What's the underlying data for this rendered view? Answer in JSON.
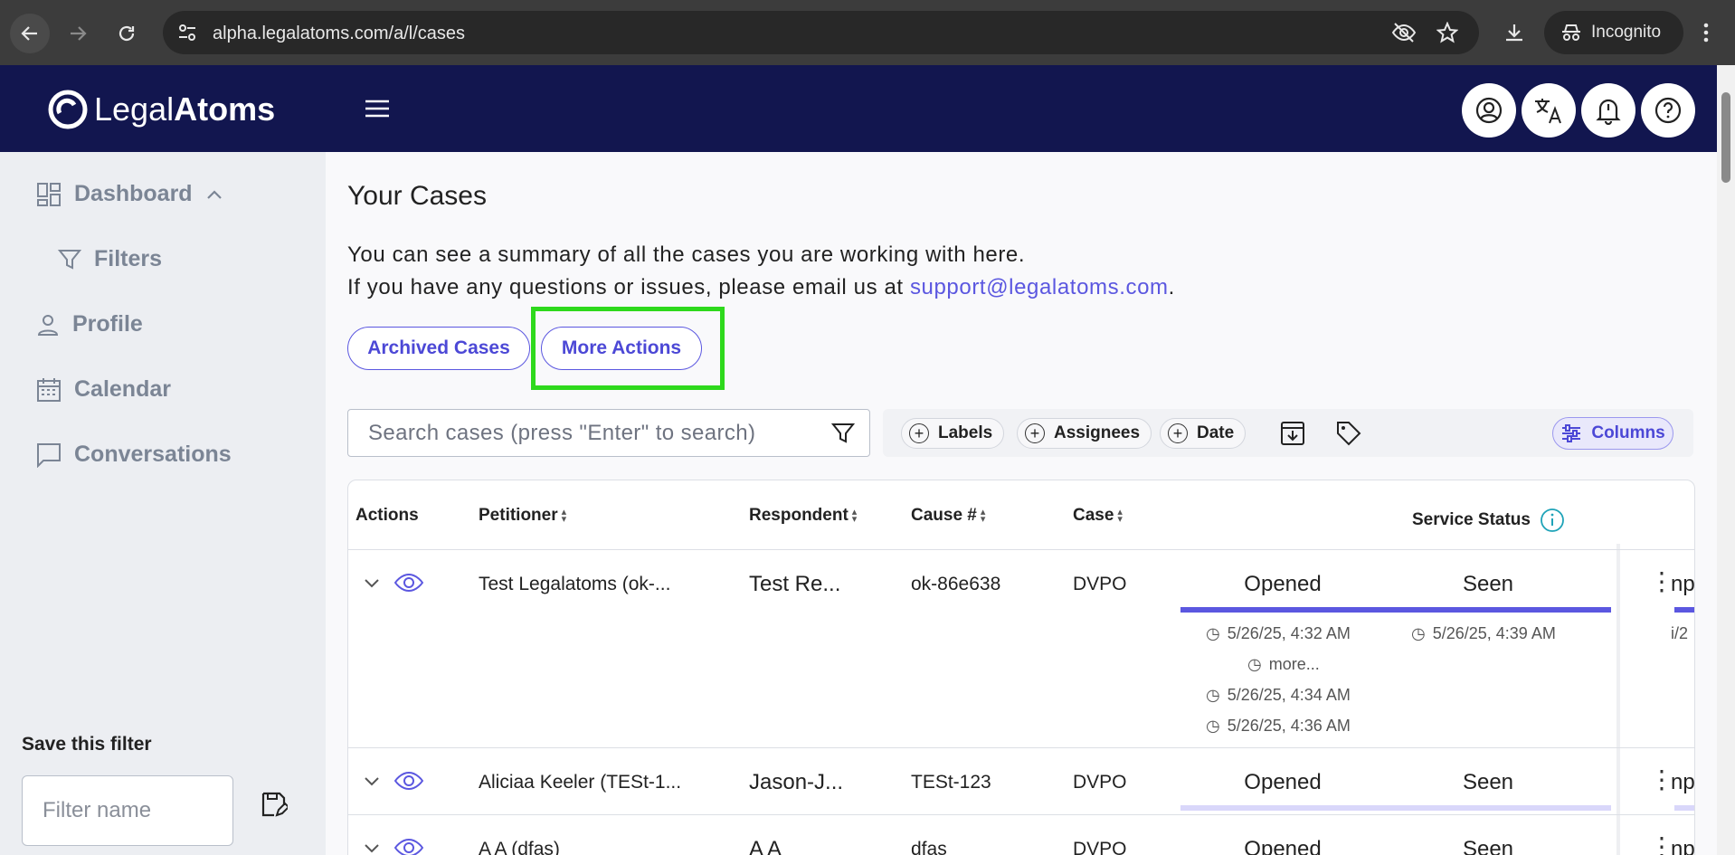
{
  "browser": {
    "url": "alpha.legalatoms.com/a/l/cases",
    "incognito_label": "Incognito"
  },
  "app": {
    "logo_light": "Legal",
    "logo_bold": "Atoms"
  },
  "sidebar": {
    "items": [
      {
        "label": "Dashboard",
        "icon": "dashboard-icon"
      },
      {
        "label": "Filters",
        "icon": "filter-icon"
      },
      {
        "label": "Profile",
        "icon": "person-icon"
      },
      {
        "label": "Calendar",
        "icon": "calendar-icon"
      },
      {
        "label": "Conversations",
        "icon": "chat-icon"
      }
    ],
    "save_filter_title": "Save this filter",
    "filter_placeholder": "Filter name"
  },
  "main": {
    "title": "Your Cases",
    "desc_line1": "You can see a summary of all the cases you are working with here.",
    "desc_line2_prefix": "If you have any questions or issues, please email us at ",
    "support_email": "support@legalatoms.com",
    "desc_line2_suffix": ".",
    "archived_button": "Archived Cases",
    "more_actions_button": "More Actions",
    "search_placeholder": "Search cases (press \"Enter\" to search)",
    "chips": [
      "Labels",
      "Assignees",
      "Date"
    ],
    "columns_button": "Columns"
  },
  "table": {
    "headers": {
      "actions": "Actions",
      "petitioner": "Petitioner",
      "respondent": "Respondent",
      "cause": "Cause #",
      "case": "Case",
      "service_status": "Service Status"
    },
    "rows": [
      {
        "petitioner": "Test Legalatoms (ok-...",
        "respondent": "Test Re...",
        "cause": "ok-86e638",
        "case": "DVPO",
        "status1": "Opened",
        "status2": "Seen",
        "ts1": [
          "5/26/25, 4:32 AM",
          "more...",
          "5/26/25, 4:34 AM",
          "5/26/25, 4:36 AM"
        ],
        "ts2": "5/26/25, 4:39 AM",
        "clipped": "np",
        "clipped_ts": "i/2"
      },
      {
        "petitioner": "Aliciaa Keeler (TESt-1...",
        "respondent": "Jason-J...",
        "cause": "TESt-123",
        "case": "DVPO",
        "status1": "Opened",
        "status2": "Seen",
        "clipped": "np"
      },
      {
        "petitioner": "A A (dfas)",
        "respondent": "A A",
        "cause": "dfas",
        "case": "DVPO",
        "status1": "Opened",
        "status2": "Seen",
        "clipped": "np"
      }
    ]
  },
  "colors": {
    "header_bg": "#12164f",
    "accent": "#5b57e0",
    "highlight": "#2ed91c"
  }
}
